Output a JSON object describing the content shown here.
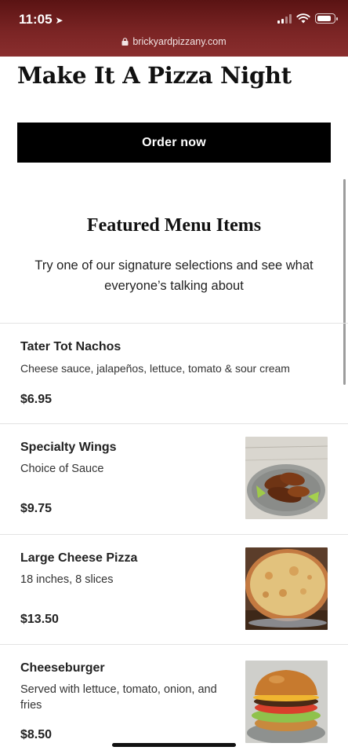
{
  "status_bar": {
    "time": "11:05",
    "url": "brickyardpizzany.com"
  },
  "hero": {
    "title": "Make It A Pizza Night",
    "order_button": "Order now"
  },
  "featured": {
    "title": "Featured Menu Items",
    "subtitle": "Try one of our signature selections and see what everyone’s talking about"
  },
  "menu": [
    {
      "name": "Tater Tot Nachos",
      "description": "Cheese sauce, jalapeños, lettuce, tomato & sour cream",
      "price": "$6.95",
      "image": "none"
    },
    {
      "name": "Specialty Wings",
      "description": "Choice of Sauce",
      "price": "$9.75",
      "image": "wings-photo"
    },
    {
      "name": "Large Cheese Pizza",
      "description": "18 inches, 8 slices",
      "price": "$13.50",
      "image": "pizza-photo"
    },
    {
      "name": "Cheeseburger",
      "description": "Served with lettuce, tomato, onion, and fries",
      "price": "$8.50",
      "image": "burger-photo"
    }
  ],
  "colors": {
    "topbar": "#7a2424",
    "button": "#000000",
    "divider": "#e3e3e3"
  }
}
